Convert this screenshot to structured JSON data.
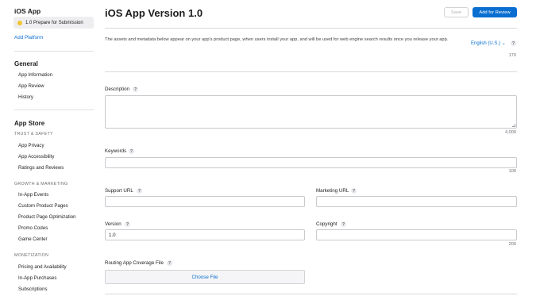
{
  "sidebar": {
    "app_title": "iOS App",
    "version_pill": "1.0 Prepare for Submission",
    "add_platform": "Add Platform",
    "general": {
      "heading": "General",
      "items": [
        "App Information",
        "App Review",
        "History"
      ]
    },
    "app_store": {
      "heading": "App Store",
      "trust_safety": {
        "label": "TRUST & SAFETY",
        "items": [
          "App Privacy",
          "App Accessibility",
          "Ratings and Reviews"
        ]
      },
      "growth_marketing": {
        "label": "GROWTH & MARKETING",
        "items": [
          "In-App Events",
          "Custom Product Pages",
          "Product Page Optimization",
          "Promo Codes",
          "Game Center"
        ]
      },
      "monetization": {
        "label": "MONETIZATION",
        "items": [
          "Pricing and Availability",
          "In-App Purchases",
          "Subscriptions"
        ]
      }
    }
  },
  "header": {
    "title": "iOS App Version 1.0",
    "save_label": "Save",
    "add_for_review_label": "Add for Review"
  },
  "intro": {
    "text": "The assets and metadata below appear on your app's product page, when users install your app, and will be used for web engine search results once you release your app.",
    "language": "English (U.S.)",
    "language_chevron": "⌄",
    "counter": "170"
  },
  "help_glyph": "?",
  "fields": {
    "description": {
      "label": "Description",
      "value": "",
      "counter": "4,000"
    },
    "keywords": {
      "label": "Keywords",
      "value": "",
      "counter": "100"
    },
    "support_url": {
      "label": "Support URL",
      "value": ""
    },
    "marketing_url": {
      "label": "Marketing URL",
      "value": ""
    },
    "version": {
      "label": "Version",
      "value": "1.0"
    },
    "copyright": {
      "label": "Copyright",
      "value": "",
      "counter": "200"
    },
    "routing_file": {
      "label": "Routing App Coverage File",
      "button": "Choose File"
    }
  },
  "colors": {
    "accent": "#0a6ed1",
    "status_dot": "#f4c430"
  }
}
